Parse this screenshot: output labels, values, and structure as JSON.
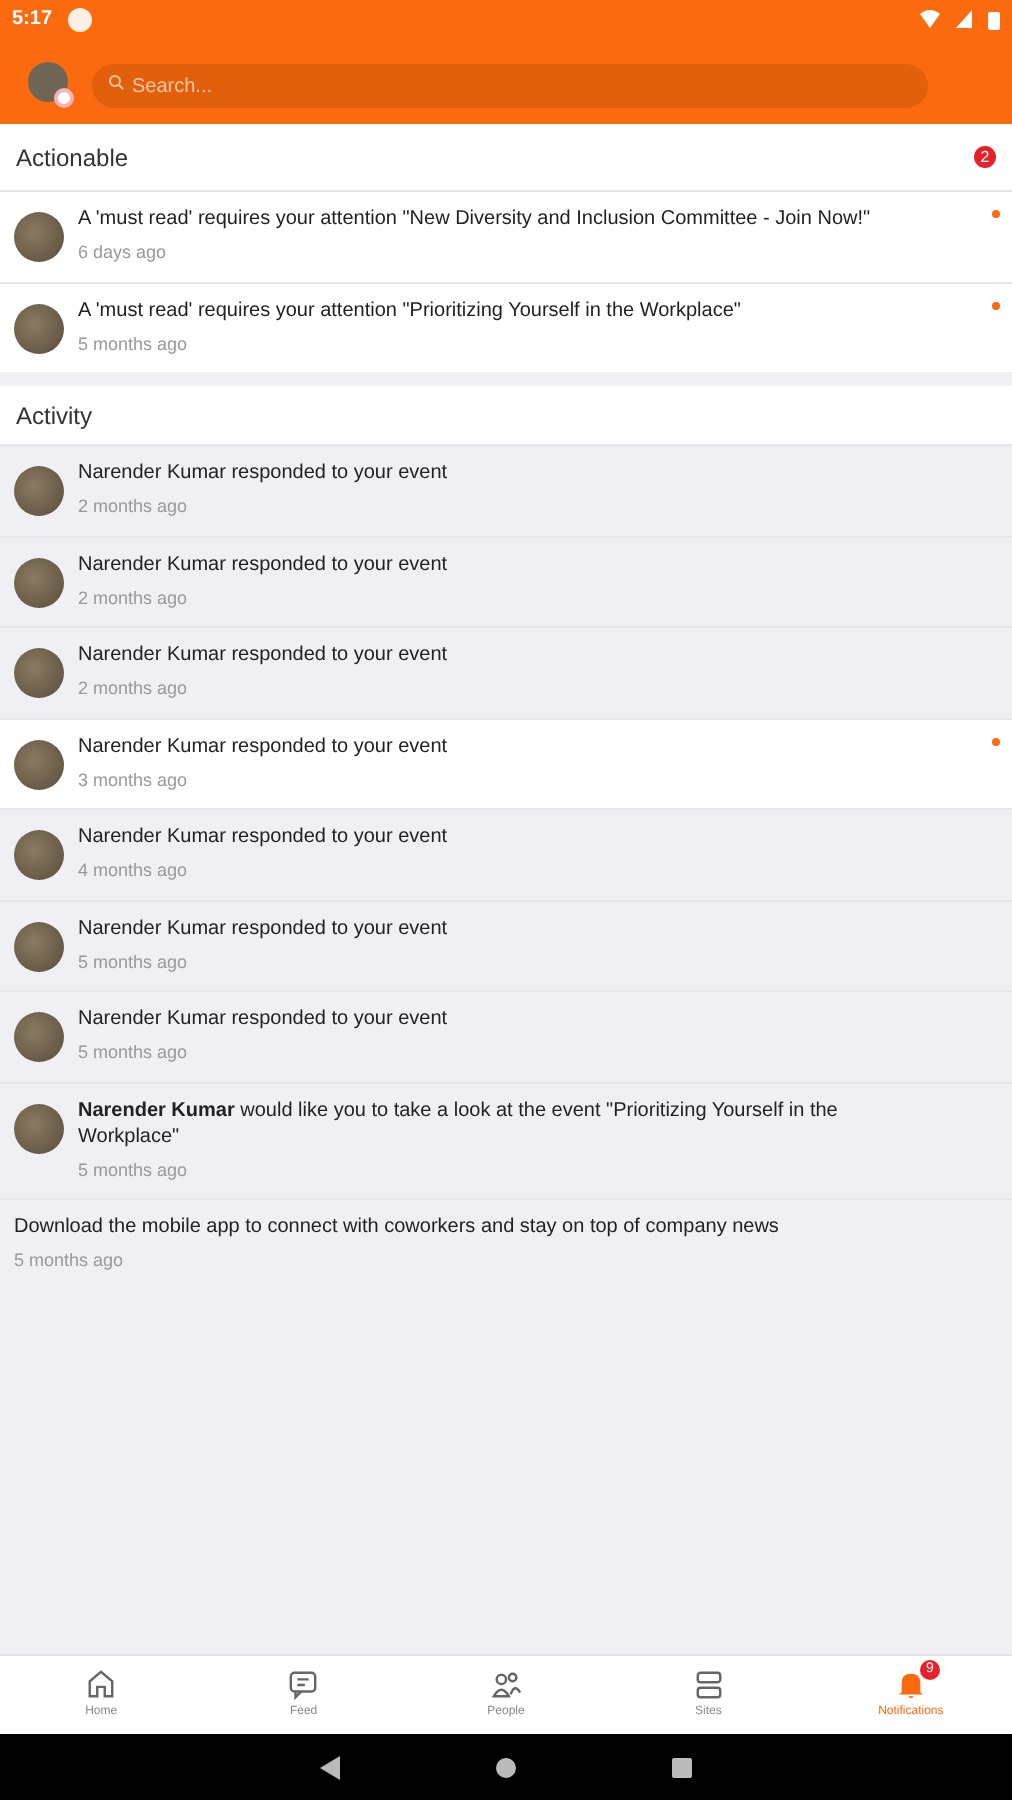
{
  "status_bar": {
    "time": "5:17"
  },
  "search": {
    "placeholder": "Search..."
  },
  "sections": [
    {
      "title": "Actionable",
      "badge": "2",
      "items": [
        {
          "kind": "person",
          "text": "A 'must read' requires your attention \"New Diversity and Inclusion Committee - Join Now!\"",
          "time": "6 days ago",
          "unread": true
        },
        {
          "kind": "person",
          "text": "A 'must read' requires your attention \"Prioritizing Yourself in the Workplace\"",
          "time": "5 months ago",
          "unread": true
        }
      ]
    },
    {
      "title": "Activity",
      "items": [
        {
          "kind": "person",
          "text": "Narender Kumar responded to your event",
          "time": "2 months ago",
          "unread": false
        },
        {
          "kind": "person",
          "text": "Narender Kumar responded to your event",
          "time": "2 months ago",
          "unread": false
        },
        {
          "kind": "person",
          "text": "Narender Kumar responded to your event",
          "time": "2 months ago",
          "unread": false
        },
        {
          "kind": "person",
          "text": "Narender Kumar responded to your event",
          "time": "3 months ago",
          "unread": true
        },
        {
          "kind": "person",
          "text": "Narender Kumar responded to your event",
          "time": "4 months ago",
          "unread": false
        },
        {
          "kind": "person",
          "text": "Narender Kumar responded to your event",
          "time": "5 months ago",
          "unread": false
        },
        {
          "kind": "person",
          "text": "Narender Kumar responded to your event",
          "time": "5 months ago",
          "unread": false
        },
        {
          "kind": "person",
          "text": "**Narender Kumar** would like you to take a look at the event \"Prioritizing Yourself in the Workplace\"",
          "time": "5 months ago",
          "unread": false
        },
        {
          "kind": "system",
          "text": "Download the mobile app to connect with coworkers and stay on top of company news",
          "time": "5 months ago",
          "unread": false
        }
      ]
    }
  ],
  "nav": [
    {
      "kind": "home",
      "label": "Home",
      "selected": false
    },
    {
      "kind": "feed",
      "label": "Feed",
      "selected": false
    },
    {
      "kind": "people",
      "label": "People",
      "selected": false
    },
    {
      "kind": "sites",
      "label": "Sites",
      "selected": false
    },
    {
      "kind": "bell",
      "label": "Notifications",
      "selected": true,
      "badge": "9"
    }
  ]
}
